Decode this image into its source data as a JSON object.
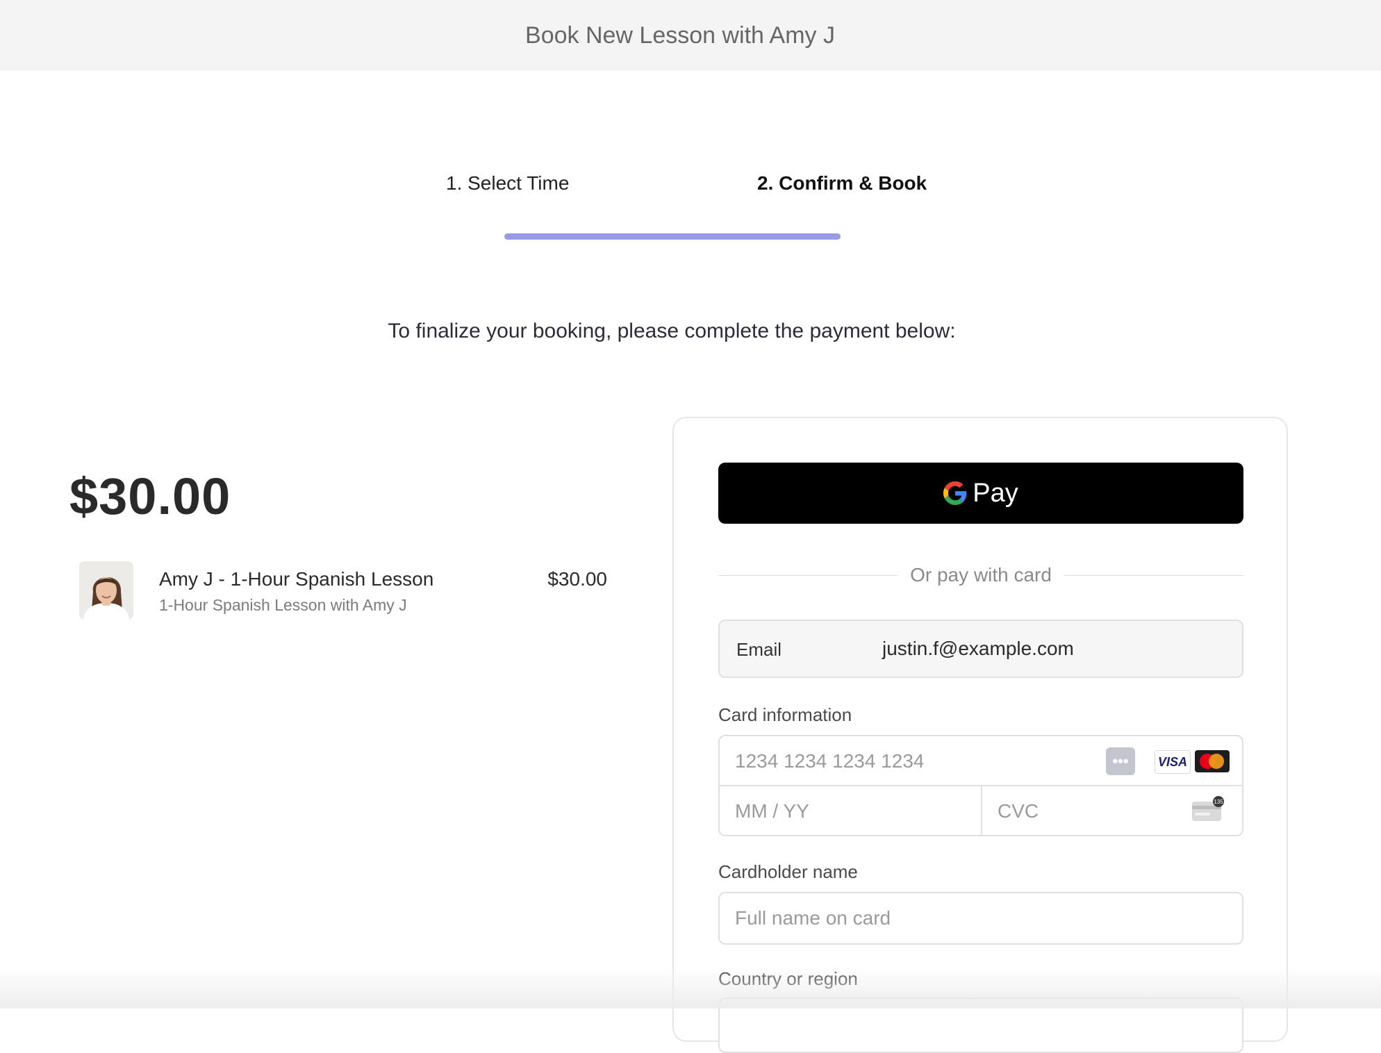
{
  "header": {
    "title": "Book New Lesson with Amy J"
  },
  "steps": [
    {
      "label": "1. Select Time"
    },
    {
      "label": "2. Confirm & Book"
    }
  ],
  "progress": {
    "color": "#9a9be6"
  },
  "instructions": "To finalize your booking, please complete the payment below:",
  "summary": {
    "total": "$30.00",
    "item": {
      "name": "Amy J - 1-Hour Spanish Lesson",
      "description": "1-Hour Spanish Lesson with Amy J",
      "price": "$30.00",
      "avatar_icon": "tutor-avatar"
    }
  },
  "payment": {
    "gpay": {
      "label": "Pay",
      "icon": "google-g-icon"
    },
    "divider_text": "Or pay with card",
    "email": {
      "label": "Email",
      "value": "justin.f@example.com"
    },
    "card": {
      "label": "Card information",
      "number_placeholder": "1234 1234 1234 1234",
      "expiry_placeholder": "MM / YY",
      "cvc_placeholder": "CVC",
      "brands": [
        "generic-card",
        "visa",
        "mastercard"
      ],
      "visa_text": "VISA",
      "cvc_badge": "135"
    },
    "cardholder": {
      "label": "Cardholder name",
      "placeholder": "Full name on card"
    },
    "country": {
      "label": "Country or region"
    }
  }
}
